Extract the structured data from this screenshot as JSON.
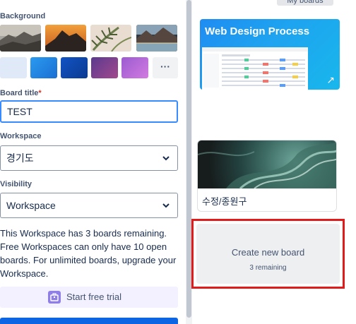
{
  "form": {
    "background_label": "Background",
    "board_title_label": "Board title",
    "required_mark": "*",
    "board_title_value": "TEST",
    "workspace_label": "Workspace",
    "workspace_value": "경기도",
    "visibility_label": "Visibility",
    "visibility_value": "Workspace",
    "more_backgrounds": "···",
    "info_text": "This Workspace has 3 boards remaining. Free Workspaces can only have 10 open boards. For unlimited boards, upgrade your Workspace.",
    "trial_label": "Start free trial"
  },
  "backgrounds": {
    "photos": [
      "landscape-rock",
      "mountain-sunset",
      "palm-leaves",
      "lake-valley"
    ],
    "colors": [
      "#dfe9f8",
      "#1f8cf2",
      "#0c4fb6",
      "#7a3f8c",
      "#b86fd6"
    ]
  },
  "boards": {
    "top_chip": "My boards",
    "web_design_title": "Web Design Process",
    "image_board_title": "수정/종원구",
    "create_new_title": "Create new board",
    "create_new_sub": "3 remaining"
  },
  "colors": {
    "accent": "#0c66e4",
    "focus_border": "#388bff",
    "highlight_box": "#e01b1b",
    "trial_bg": "#f3f0ff"
  }
}
